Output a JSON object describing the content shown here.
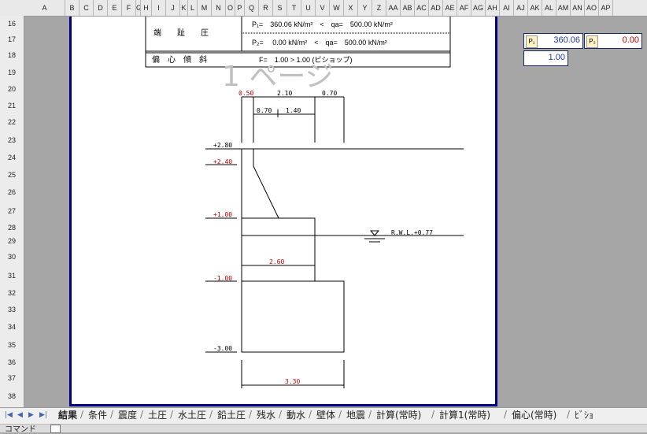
{
  "columns": [
    "A",
    "B",
    "C",
    "D",
    "E",
    "F",
    "G",
    "H",
    "I",
    "J",
    "K",
    "L",
    "M",
    "N",
    "O",
    "P",
    "Q",
    "R",
    "S",
    "T",
    "U",
    "V",
    "W",
    "X",
    "Y",
    "Z",
    "AA",
    "AB",
    "AC",
    "AD",
    "AE",
    "AF",
    "AG",
    "AH",
    "AI",
    "AJ",
    "AK",
    "AL",
    "AM",
    "AN",
    "AO",
    "AP"
  ],
  "rows": [
    "16",
    "17",
    "18",
    "19",
    "20",
    "21",
    "22",
    "23",
    "24",
    "25",
    "26",
    "27",
    "28",
    "29",
    "30",
    "31",
    "32",
    "33",
    "34",
    "35",
    "36",
    "37",
    "38"
  ],
  "page_watermark": "1 ページ",
  "table": {
    "row1_label": "端　　趾　　圧",
    "row1_line1": "P₁=　360.06 kN/m²　<　qa=　500.00 kN/m²",
    "row1_line2": "P₂=　 0.00 kN/m²　<　qa=　500.00 kN/m²",
    "row2_label": "偏　心　傾　斜",
    "row2_value": "F=　1.00 > 1.00 (ビショップ)"
  },
  "drawing": {
    "dims_top": [
      "0.50",
      "2.10",
      "0.70"
    ],
    "dims_mid": [
      "0.70",
      "1.40"
    ],
    "levels": [
      "+2.80",
      "+2.40",
      "+1.00",
      "-1.00",
      "-3.00"
    ],
    "width_upper": "2.60",
    "width_base": "3.30",
    "water_label": "R.W.L.+0.77"
  },
  "results": {
    "p1_label": "P₁",
    "p1_value": "360.06",
    "p2_label": "P₂",
    "p2_value": "0.00",
    "f_value": "1.00"
  },
  "tabs": [
    "結果",
    "条件",
    "震度",
    "土圧",
    "水土圧",
    "鉛土圧",
    "残水",
    "動水",
    "壁体",
    "地震",
    "計算(常時)",
    "計算1(常時)",
    "偏心(常時)",
    "ﾋﾞｼｮ"
  ],
  "status": {
    "text": "コマンド"
  },
  "colors": {
    "navy": "#00008b",
    "red": "#c00000",
    "blue": "#1f3a9e"
  }
}
